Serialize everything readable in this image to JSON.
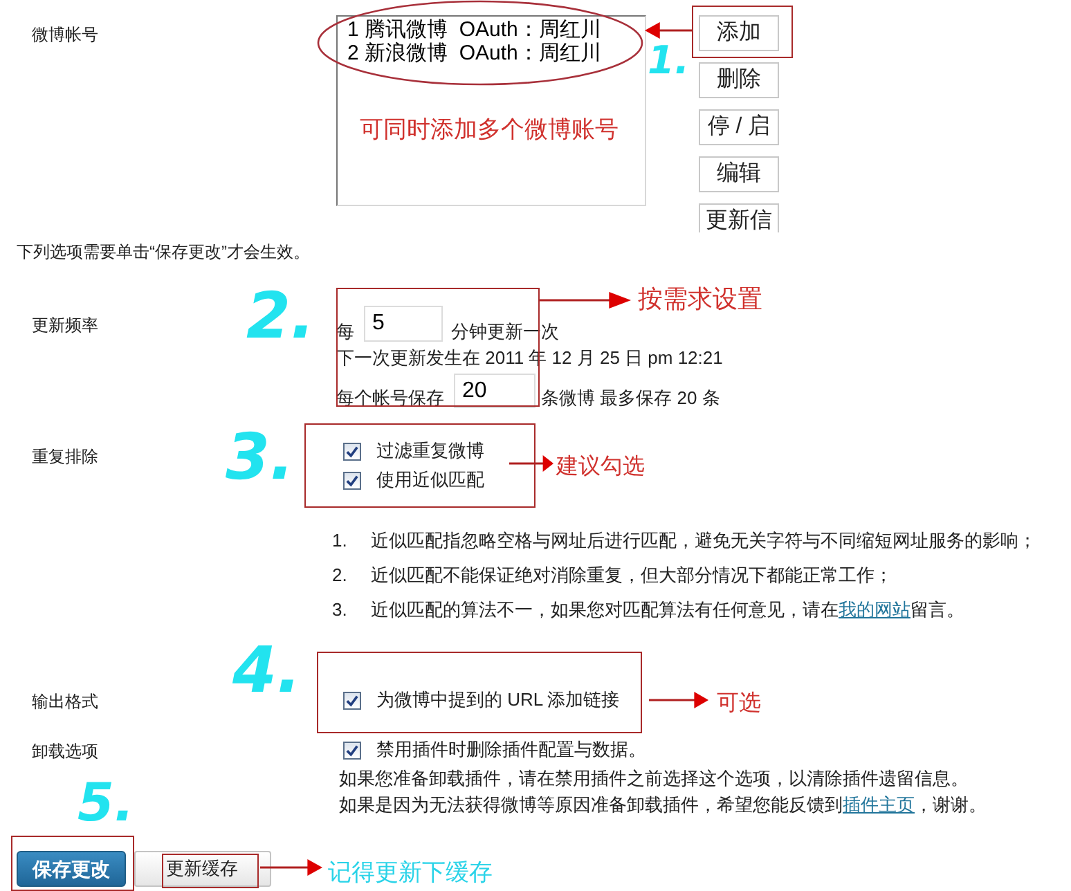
{
  "accounts": {
    "label": "微博帐号",
    "items": [
      {
        "text": "1 腾讯微博  OAuth：周红川"
      },
      {
        "text": "2 新浪微博  OAuth：周红川"
      }
    ],
    "buttons": [
      "添加",
      "删除",
      "停 / 启",
      "编辑",
      "更新信"
    ]
  },
  "notice": "下列选项需要单击“保存更改”才会生效。",
  "update_frequency": {
    "label": "更新频率",
    "prefix": "每",
    "interval": "5",
    "interval_suffix": "分钟更新一次",
    "next_update": "下一次更新发生在 2011 年 12 月 25 日 pm 12:21",
    "keep_prefix": "每个帐号保存",
    "keep_value": "20",
    "keep_suffix": "条微博 最多保存 20 条"
  },
  "dedupe": {
    "label": "重复排除",
    "options": [
      {
        "label": "过滤重复微博",
        "checked": true
      },
      {
        "label": "使用近似匹配",
        "checked": true
      }
    ],
    "notes": [
      {
        "number": "1.",
        "text": "近似匹配指忽略空格与网址后进行匹配，避免无关字符与不同缩短网址服务的影响；"
      },
      {
        "number": "2.",
        "text": "近似匹配不能保证绝对消除重复，但大部分情况下都能正常工作；"
      },
      {
        "number": "3.",
        "text": "近似匹配的算法不一，如果您对匹配算法有任何意见，请在",
        "link": "我的网站",
        "text_after": "留言。"
      }
    ]
  },
  "output_format": {
    "label": "输出格式",
    "option": {
      "label": "为微博中提到的 URL 添加链接",
      "checked": true
    }
  },
  "uninstall": {
    "label": "卸载选项",
    "option": {
      "label": "禁用插件时删除插件配置与数据。",
      "checked": true
    },
    "help": [
      {
        "text": "如果您准备卸载插件，请在禁用插件之前选择这个选项，以清除插件遗留信息。"
      },
      {
        "text": "如果是因为无法获得微博等原因准备卸载插件，希望您能反馈到",
        "link": "插件主页",
        "text_after": "，谢谢。"
      }
    ]
  },
  "buttons": [
    {
      "label": "保存更改",
      "kind": "primary"
    },
    {
      "label": "更新缓存",
      "kind": "secondary"
    }
  ],
  "annotations": {
    "steps": [
      "1.",
      "2.",
      "3.",
      "4.",
      "5."
    ],
    "notes": [
      {
        "text": "可同时添加多个微博账号",
        "color": "#d0312d"
      },
      {
        "text": "按需求设置",
        "color": "#d0312d"
      },
      {
        "text": "建议勾选",
        "color": "#d0312d"
      },
      {
        "text": "可选",
        "color": "#d0312d"
      },
      {
        "text": "记得更新下缓存",
        "color": "#29d3e8"
      }
    ]
  }
}
